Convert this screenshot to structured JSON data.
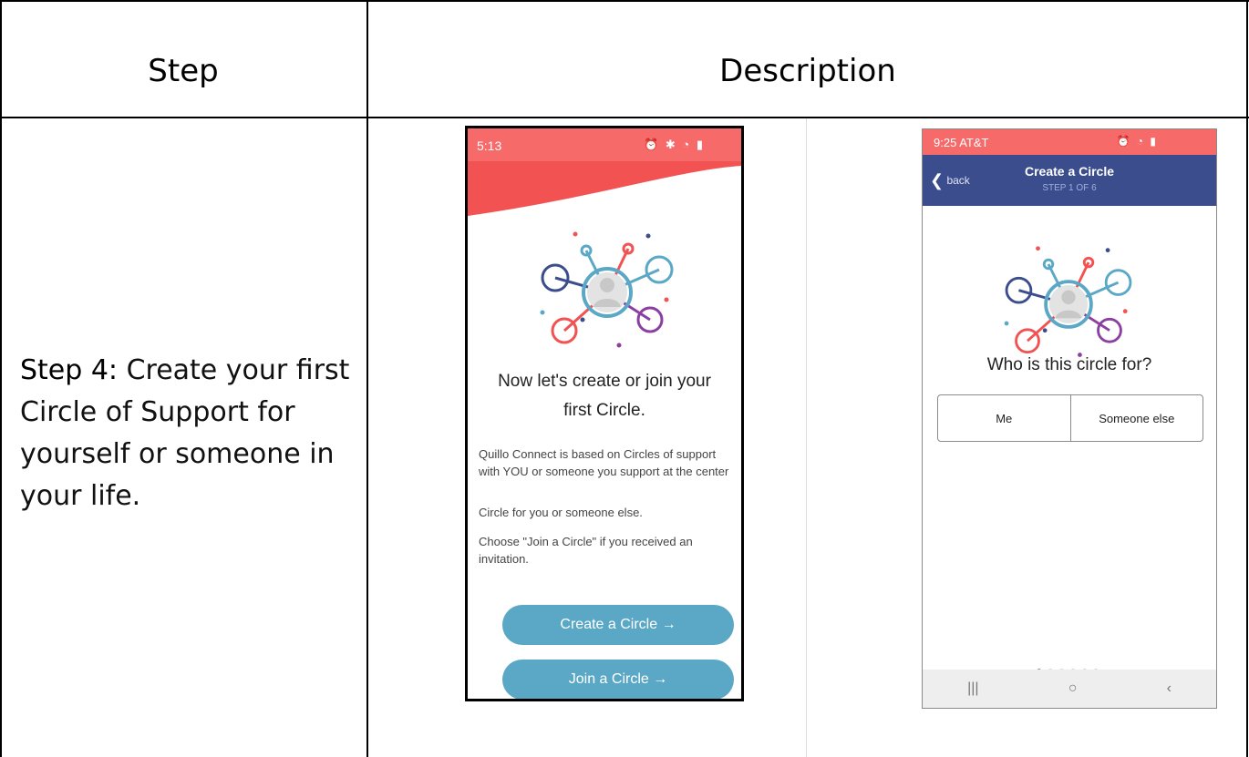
{
  "table": {
    "header_step": "Step",
    "header_description": "Description",
    "step_label": "Step 4:",
    "step_text": " Create your first Circle of Support for yourself or someone in your life."
  },
  "phone_left": {
    "status_time": "5:13",
    "status_icons": "⏰ ✱ ◔ ▮",
    "title_line1": "Now let's create or join your",
    "title_line2": "first Circle.",
    "paragraph1": "Quillo Connect is based on Circles of support with YOU or someone you support at the center",
    "paragraph2": "Circle for you or someone else.",
    "paragraph3": "Choose \"Join a Circle\" if you received an invitation.",
    "button_create": "Create a Circle →",
    "button_join": "Join a Circle →"
  },
  "phone_right": {
    "status_time": "9:25 AT&T",
    "status_icons": "⏰ ◔ ▮",
    "back_label": "back",
    "header_title": "Create a Circle",
    "header_subtitle": "STEP 1 OF 6",
    "question": "Who is this circle for?",
    "option_me": "Me",
    "option_someone_else": "Someone else",
    "nav_recents": "|||",
    "nav_home": "○",
    "nav_back": "‹"
  },
  "colors": {
    "status_bar": "#f76a6a",
    "header_blue": "#3b4d8c",
    "button_teal": "#5aa8c5"
  }
}
